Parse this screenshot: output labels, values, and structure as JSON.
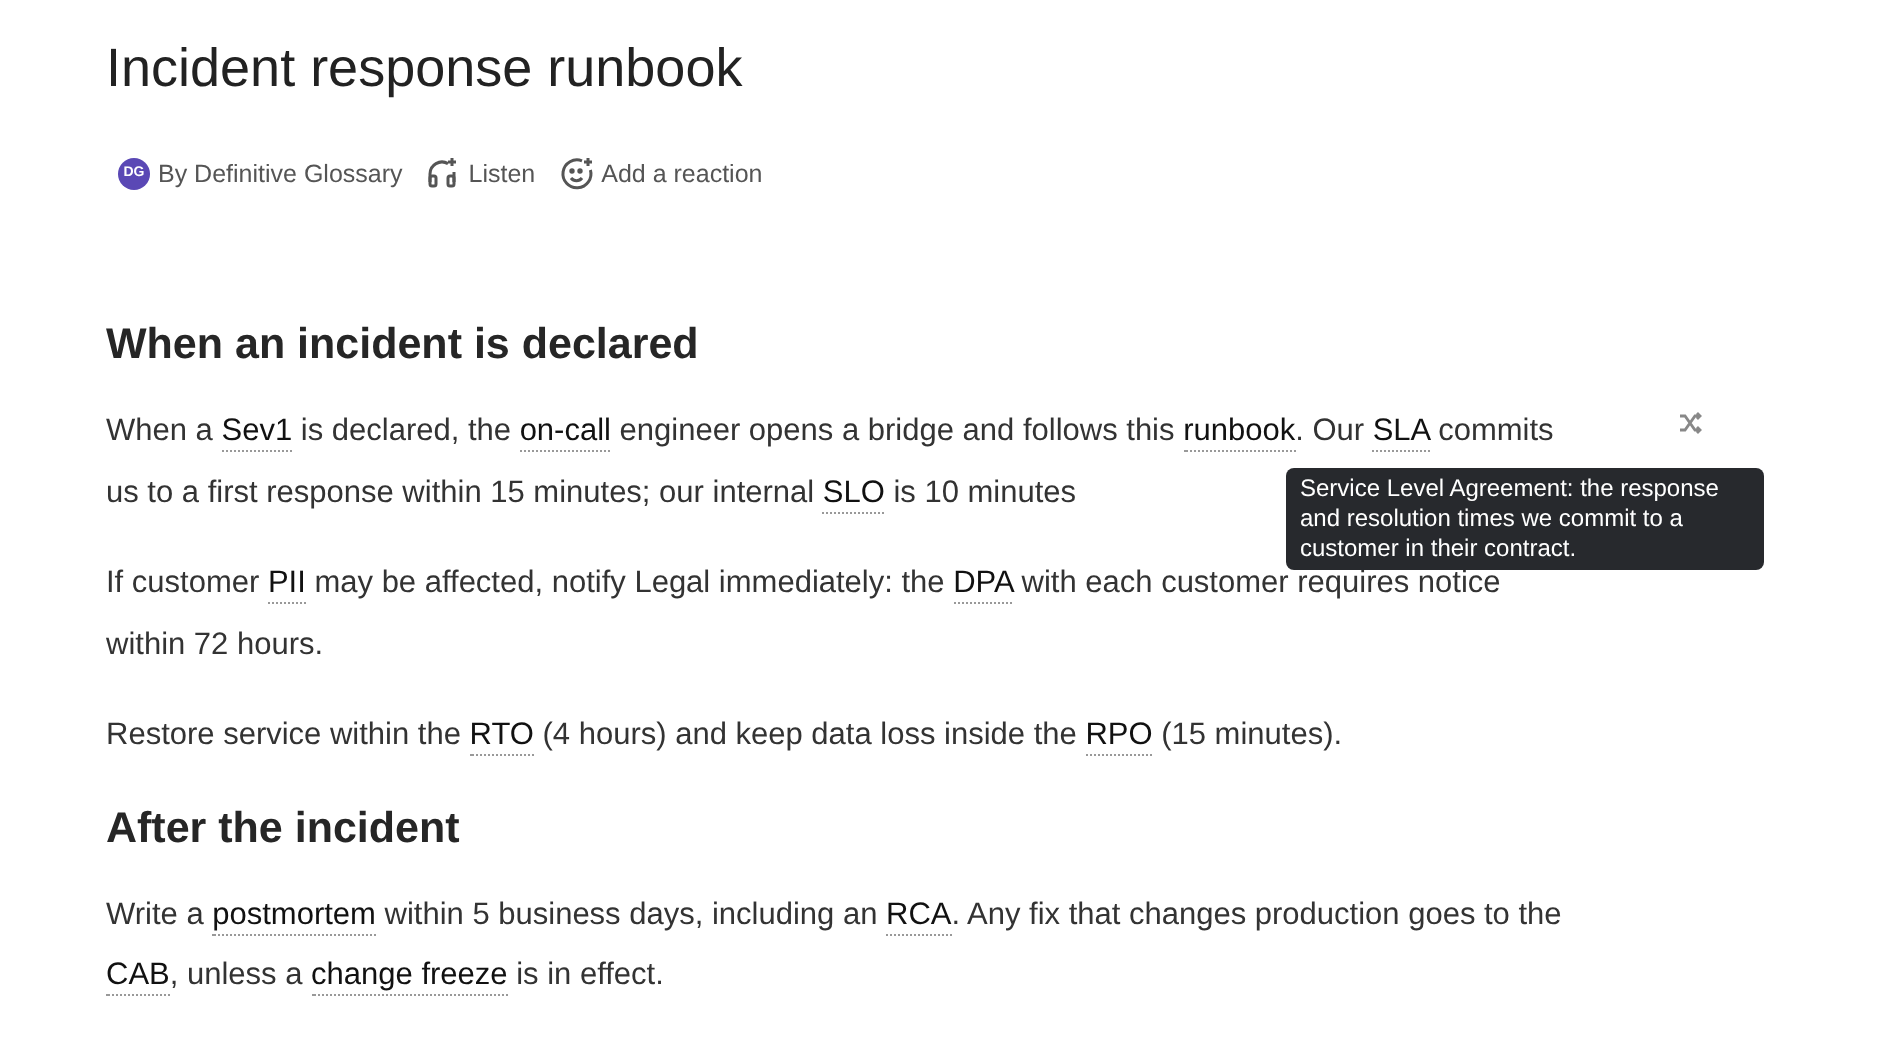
{
  "title": "Incident response runbook",
  "meta": {
    "avatar_initials": "DG",
    "author": "By Definitive Glossary",
    "listen": "Listen",
    "reaction": "Add a reaction"
  },
  "sections": [
    {
      "heading": "When an incident is declared",
      "paragraphs": [
        [
          {
            "kind": "text",
            "text": "When a "
          },
          {
            "kind": "term",
            "text": "Sev1"
          },
          {
            "kind": "text",
            "text": " is declared, the "
          },
          {
            "kind": "term",
            "text": "on-call"
          },
          {
            "kind": "text",
            "text": " engineer opens a bridge and follows this "
          },
          {
            "kind": "term",
            "text": "runbook"
          },
          {
            "kind": "text",
            "text": ". Our "
          },
          {
            "kind": "term",
            "text": "SLA"
          },
          {
            "kind": "text",
            "text": " commits us to a first response within 15 minutes; our internal "
          },
          {
            "kind": "term",
            "text": "SLO"
          },
          {
            "kind": "text",
            "text": " is 10 minutes"
          }
        ],
        [
          {
            "kind": "text",
            "text": "If customer "
          },
          {
            "kind": "term",
            "text": "PII"
          },
          {
            "kind": "text",
            "text": " may be affected, notify Legal immediately: the "
          },
          {
            "kind": "term",
            "text": "DPA"
          },
          {
            "kind": "text",
            "text": " with each customer requires notice within 72 hours."
          }
        ],
        [
          {
            "kind": "text",
            "text": "Restore service within the "
          },
          {
            "kind": "term",
            "text": "RTO"
          },
          {
            "kind": "text",
            "text": " (4 hours) and keep data loss inside the "
          },
          {
            "kind": "term",
            "text": "RPO"
          },
          {
            "kind": "text",
            "text": " (15 minutes)."
          }
        ]
      ]
    },
    {
      "heading": "After the incident",
      "paragraphs": [
        [
          {
            "kind": "text",
            "text": "Write a "
          },
          {
            "kind": "term",
            "text": "postmortem"
          },
          {
            "kind": "text",
            "text": " within 5 business days, including an "
          },
          {
            "kind": "term",
            "text": "RCA"
          },
          {
            "kind": "text",
            "text": ". Any fix that changes production goes to the "
          },
          {
            "kind": "term",
            "text": "CAB"
          },
          {
            "kind": "text",
            "text": ", unless a "
          },
          {
            "kind": "term",
            "text": "change freeze"
          },
          {
            "kind": "text",
            "text": " is in effect."
          }
        ]
      ]
    }
  ],
  "tooltip": {
    "text": "Service Level Agreement: the response and resolution times we commit to a customer in their contract."
  }
}
